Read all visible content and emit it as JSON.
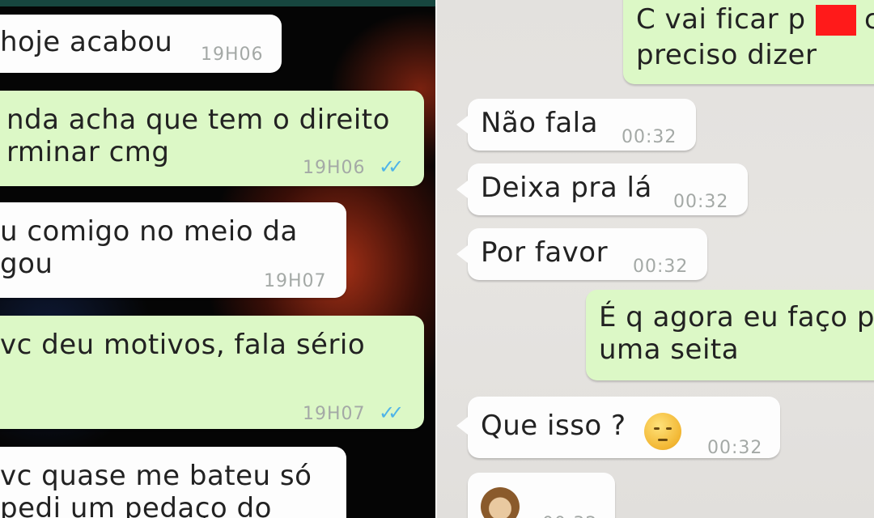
{
  "left_chat": {
    "messages": [
      {
        "text": "hoje acabou",
        "time": "19H06",
        "sent": false
      },
      {
        "text": "nda acha que tem o direito\nrminar cmg",
        "time": "19H06",
        "sent": true
      },
      {
        "text": "u comigo no meio da\ngou",
        "time": "19H07",
        "sent": false
      },
      {
        "text": "vc deu motivos, fala sério",
        "time": "19H07",
        "sent": true
      },
      {
        "text": "vc quase me bateu só\npedi um pedaço do",
        "time": "",
        "sent": false
      }
    ]
  },
  "right_chat": {
    "messages": [
      {
        "text": "C vai ficar p",
        "text_tail": "c",
        "line2": "preciso dizer",
        "time": "",
        "sent": true
      },
      {
        "text": "Não fala",
        "time": "00:32",
        "sent": false
      },
      {
        "text": "Deixa pra lá",
        "time": "00:32",
        "sent": false
      },
      {
        "text": "Por favor",
        "time": "00:32",
        "sent": false
      },
      {
        "text": "É q agora eu faço p\numa seita",
        "time": "",
        "sent": true
      },
      {
        "text": "Que isso ?",
        "time": "00:32",
        "sent": false,
        "emoji": "worried-face"
      },
      {
        "text": "",
        "time": "00:32",
        "sent": false,
        "emoji": "monkey-face"
      }
    ]
  },
  "colors": {
    "incoming_bubble": "#fdfdfd",
    "outgoing_bubble": "#dcf8c6",
    "read_ticks": "#4fb4e8",
    "redaction": "#ff1a1a"
  },
  "icons": {
    "read_receipt": "double-check-icon"
  }
}
